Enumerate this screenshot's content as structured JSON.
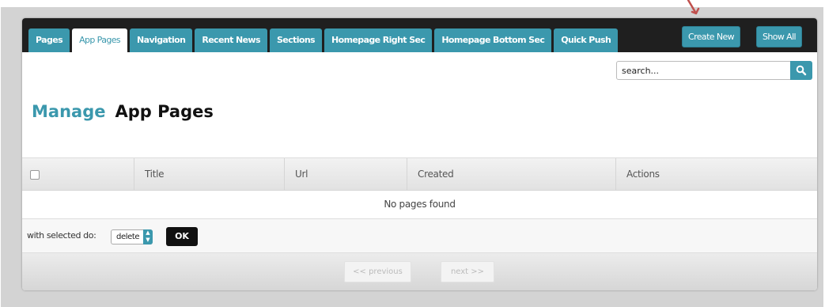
{
  "tabs": [
    {
      "label": "Pages"
    },
    {
      "label": "App Pages",
      "active": true
    },
    {
      "label": "Navigation"
    },
    {
      "label": "Recent News"
    },
    {
      "label": "Sections"
    },
    {
      "label": "Homepage Right Sec"
    },
    {
      "label": "Homepage Bottom Sec"
    },
    {
      "label": "Quick Push"
    }
  ],
  "actions": {
    "create_new": "Create New",
    "show_all": "Show All"
  },
  "search": {
    "value": "search...",
    "icon": "search-icon"
  },
  "heading": {
    "prefix": "Manage",
    "title": "App Pages"
  },
  "table": {
    "columns": [
      "Title",
      "Url",
      "Created",
      "Actions"
    ],
    "empty_message": "No pages found"
  },
  "bulk": {
    "label": "with selected do:",
    "selected_option": "delete",
    "ok_label": "OK"
  },
  "pagination": {
    "previous": "<< previous",
    "next": "next >>"
  },
  "colors": {
    "accent": "#3b98ad",
    "topbar": "#1f1f1f",
    "annotation_arrow": "#c0504d"
  }
}
